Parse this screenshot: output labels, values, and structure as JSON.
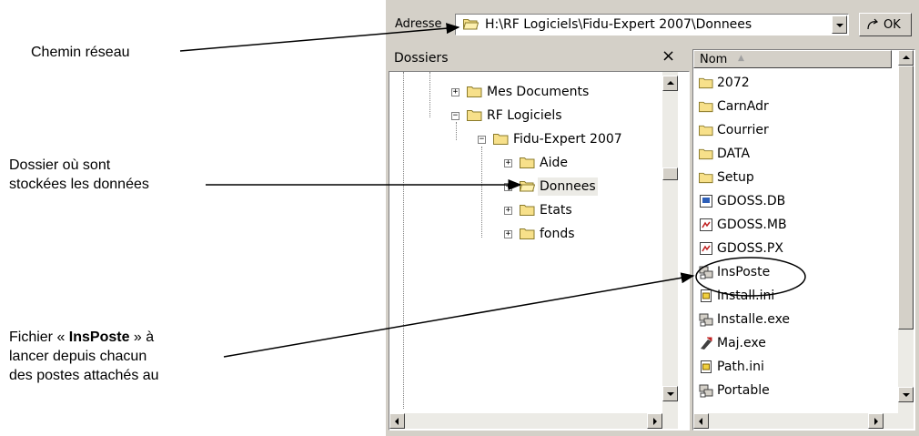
{
  "annotations": {
    "network_path": "Chemin réseau",
    "data_folder_line1": "Dossier où sont",
    "data_folder_line2": "stockées les données",
    "insposte_pre": "Fichier « ",
    "insposte_bold": "InsPoste",
    "insposte_post": " » à",
    "insposte_line2": "lancer depuis chacun",
    "insposte_line3": "des postes attachés au"
  },
  "address": {
    "label": "Adresse",
    "path": "H:\\RF Logiciels\\Fidu-Expert 2007\\Donnees",
    "go_label": "OK"
  },
  "folders_pane": {
    "title": "Dossiers",
    "close": "×",
    "tree": [
      "Mes Documents",
      "RF Logiciels",
      "Fidu-Expert 2007",
      "Aide",
      "Donnees",
      "Etats",
      "fonds"
    ],
    "selected": "Donnees"
  },
  "files_pane": {
    "column_name": "Nom",
    "sort_indicator": "▲",
    "items": [
      {
        "name": "2072",
        "icon": "folder-icon"
      },
      {
        "name": "CarnAdr",
        "icon": "folder-icon"
      },
      {
        "name": "Courrier",
        "icon": "folder-icon"
      },
      {
        "name": "DATA",
        "icon": "folder-icon"
      },
      {
        "name": "Setup",
        "icon": "folder-icon"
      },
      {
        "name": "GDOSS.DB",
        "icon": "db-file-icon"
      },
      {
        "name": "GDOSS.MB",
        "icon": "mb-file-icon"
      },
      {
        "name": "GDOSS.PX",
        "icon": "px-file-icon"
      },
      {
        "name": "InsPoste",
        "icon": "shortcut-app-icon"
      },
      {
        "name": "Install.ini",
        "icon": "ini-file-icon"
      },
      {
        "name": "Installe.exe",
        "icon": "exe-icon"
      },
      {
        "name": "Maj.exe",
        "icon": "exe-icon"
      },
      {
        "name": "Path.ini",
        "icon": "ini-file-icon"
      },
      {
        "name": "Portable",
        "icon": "shortcut-app-icon"
      }
    ]
  },
  "colors": {
    "window_face": "#d4d0c8",
    "folder_yellow": "#f7e08a",
    "selection": "#ecebe6"
  }
}
